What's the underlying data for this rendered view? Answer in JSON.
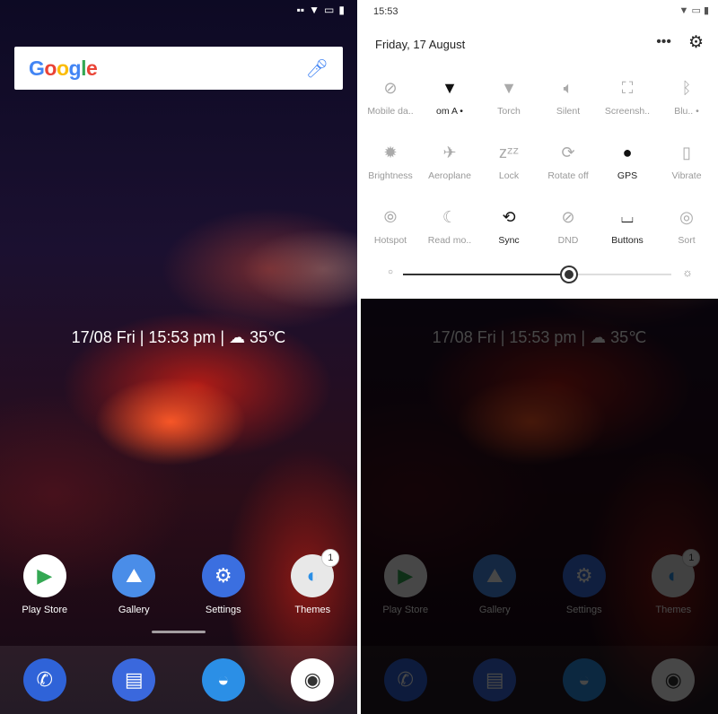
{
  "home": {
    "search": {
      "logo": "Google",
      "icon": "mic-icon"
    },
    "clock_widget": "17/08  Fri | 15:53  pm |  ☁ 35℃",
    "apps": [
      {
        "label": "Play Store",
        "icon": "play-store-icon",
        "color": "#ffffff"
      },
      {
        "label": "Gallery",
        "icon": "gallery-icon",
        "color": "#4a8de8"
      },
      {
        "label": "Settings",
        "icon": "settings-icon",
        "color": "#3b6fe0"
      },
      {
        "label": "Themes",
        "icon": "themes-icon",
        "color": "#e8e8e8",
        "badge": "1"
      }
    ],
    "dock": [
      {
        "icon": "phone-icon",
        "color": "#2f63d8"
      },
      {
        "icon": "messages-icon",
        "color": "#3a68dd"
      },
      {
        "icon": "browser-icon",
        "color": "#2b8fe6"
      },
      {
        "icon": "camera-icon",
        "color": "#ffffff"
      }
    ]
  },
  "quick_settings": {
    "time": "15:53",
    "date": "Friday, 17 August",
    "tiles": [
      {
        "label": "Mobile da..",
        "icon": "mobile-data-off-icon",
        "state": "off"
      },
      {
        "label": "om A •",
        "icon": "wifi-icon",
        "state": "on"
      },
      {
        "label": "Torch",
        "icon": "torch-icon",
        "state": "off"
      },
      {
        "label": "Silent",
        "icon": "volume-icon",
        "state": "off"
      },
      {
        "label": "Screensh..",
        "icon": "screenshot-icon",
        "state": "off"
      },
      {
        "label": "Blu.. •",
        "icon": "bluetooth-off-icon",
        "state": "off"
      },
      {
        "label": "Brightness",
        "icon": "brightness-icon",
        "state": "off"
      },
      {
        "label": "Aeroplane",
        "icon": "aeroplane-icon",
        "state": "off"
      },
      {
        "label": "Lock",
        "icon": "sleep-lock-icon",
        "state": "off"
      },
      {
        "label": "Rotate off",
        "icon": "rotate-icon",
        "state": "off"
      },
      {
        "label": "GPS",
        "icon": "location-icon",
        "state": "on"
      },
      {
        "label": "Vibrate",
        "icon": "vibrate-icon",
        "state": "off"
      },
      {
        "label": "Hotspot",
        "icon": "hotspot-icon",
        "state": "off"
      },
      {
        "label": "Read mo..",
        "icon": "moon-icon",
        "state": "off"
      },
      {
        "label": "Sync",
        "icon": "sync-icon",
        "state": "on"
      },
      {
        "label": "DND",
        "icon": "dnd-icon",
        "state": "off"
      },
      {
        "label": "Buttons",
        "icon": "buttons-icon",
        "state": "on"
      },
      {
        "label": "Sort",
        "icon": "sort-icon",
        "state": "off"
      }
    ],
    "brightness_percent": 62
  }
}
